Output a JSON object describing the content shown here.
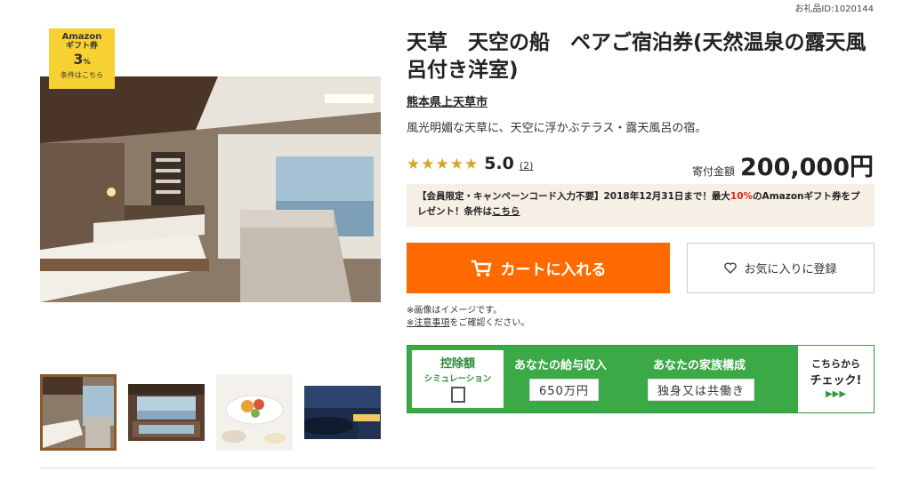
{
  "item_id": "お礼品ID:1020144",
  "badge": {
    "line1": "Amazon",
    "line2": "ギフト券",
    "value": "3",
    "unit": "%",
    "note": "条件はこちら"
  },
  "title": "天草　天空の船　ペアご宿泊券(天然温泉の露天風呂付き洋室)",
  "region": "熊本県上天草市",
  "catch": "風光明媚な天草に、天空に浮かぶテラス・露天風呂の宿。",
  "rating": {
    "stars": "★★★★★",
    "score": "5.0",
    "count": "(2)"
  },
  "price": {
    "label": "寄付金額",
    "amount": "200,000円"
  },
  "campaign": {
    "pre": "【会員限定・キャンペーンコード入力不要】2018年12月31日まで！最大",
    "highlight": "10%",
    "post": "のAmazonギフト券をプレゼント！条件は",
    "link": "こちら"
  },
  "cart_button": "カートに入れる",
  "fav_button": "お気に入りに登録",
  "notes": {
    "line1": "※画像はイメージです。",
    "line2_link": "※注意事項",
    "line2_rest": "をご確認ください。"
  },
  "simulation": {
    "title": "控除額",
    "subtitle": "シミュレーション",
    "income_label": "あなたの給与収入",
    "income_value": "650万円",
    "family_label": "あなたの家族構成",
    "family_value": "独身又は共働き",
    "cta1": "こちらから",
    "cta2": "チェック!",
    "cta3": "▶▶▶"
  },
  "colors": {
    "accent": "#ff6a00",
    "badge": "#f7d131",
    "sim_green": "#3aa946",
    "star": "#d9a32b"
  }
}
